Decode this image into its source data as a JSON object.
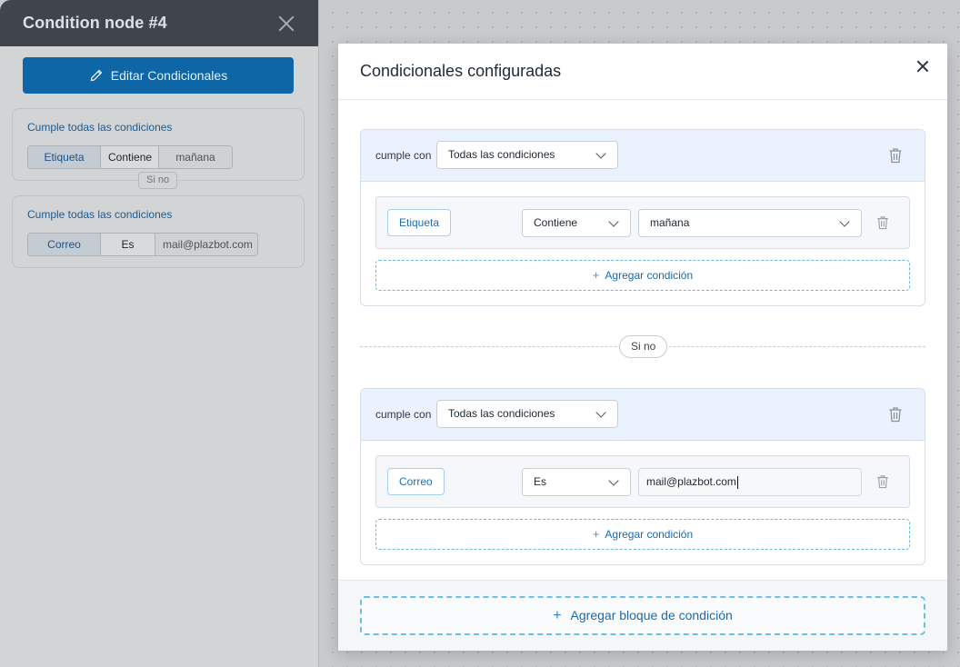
{
  "side_panel": {
    "title": "Condition node #4",
    "edit_button_label": "Editar Condicionales",
    "cards": [
      {
        "title": "Cumple todas las condiciones",
        "field": "Etiqueta",
        "operator": "Contiene",
        "value": "mañana"
      },
      {
        "title": "Cumple todas las condiciones",
        "field": "Correo",
        "operator": "Es",
        "value": "mail@plazbot.com"
      }
    ],
    "else_label": "Si no"
  },
  "modal": {
    "title": "Condicionales configuradas",
    "blocks": [
      {
        "match_label": "cumple con",
        "match_value": "Todas las condiciones",
        "condition": {
          "field": "Etiqueta",
          "operator": "Contiene",
          "value": "mañana"
        },
        "add_condition_label": "Agregar condición"
      },
      {
        "match_label": "cumple con",
        "match_value": "Todas las condiciones",
        "condition": {
          "field": "Correo",
          "operator": "Es",
          "value": "mail@plazbot.com"
        },
        "add_condition_label": "Agregar condición"
      }
    ],
    "else_label": "Si no",
    "add_block_label": "Agregar bloque de condición"
  },
  "colors": {
    "primary": "#0e66a6",
    "accent": "#1f6fb0",
    "header_dark": "#40444c"
  }
}
